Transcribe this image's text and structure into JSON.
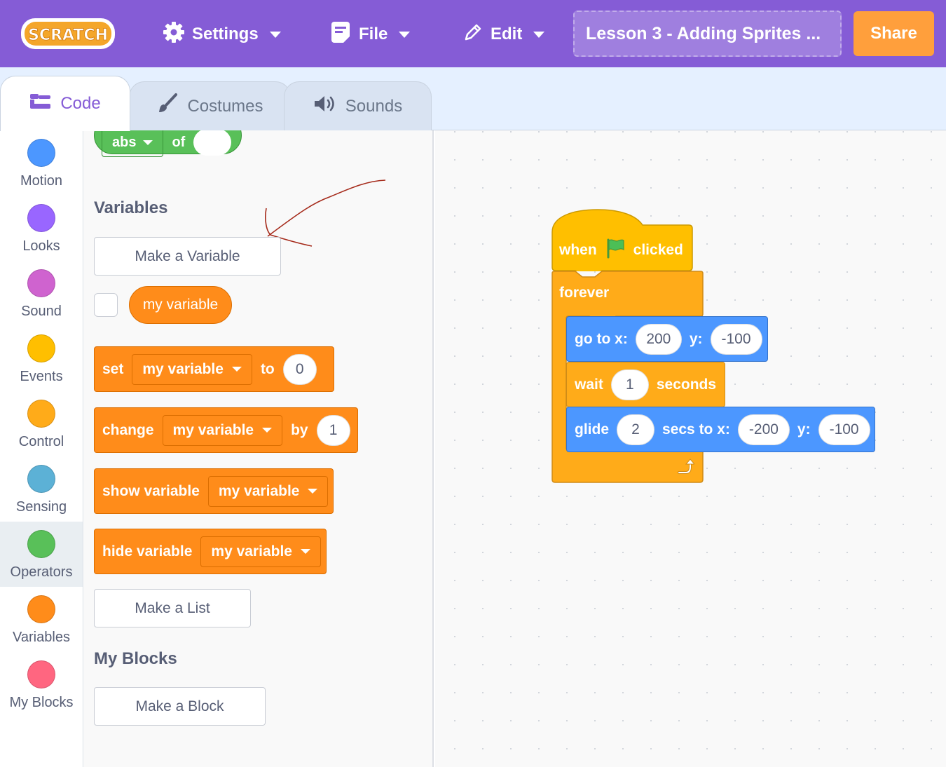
{
  "menubar": {
    "logo_text": "SCRATCH",
    "settings_label": "Settings",
    "file_label": "File",
    "edit_label": "Edit",
    "project_title": "Lesson 3 - Adding Sprites ...",
    "share_label": "Share",
    "color": "#855cd6"
  },
  "tabs": {
    "code_label": "Code",
    "costumes_label": "Costumes",
    "sounds_label": "Sounds"
  },
  "categories": [
    {
      "label": "Motion",
      "color": "#4c97ff"
    },
    {
      "label": "Looks",
      "color": "#9966ff"
    },
    {
      "label": "Sound",
      "color": "#cf63cf"
    },
    {
      "label": "Events",
      "color": "#ffbf00"
    },
    {
      "label": "Control",
      "color": "#ffab19"
    },
    {
      "label": "Sensing",
      "color": "#5cb1d6"
    },
    {
      "label": "Operators",
      "color": "#59c059"
    },
    {
      "label": "Variables",
      "color": "#ff8c1a"
    },
    {
      "label": "My Blocks",
      "color": "#ff6680"
    }
  ],
  "palette": {
    "abs_block": {
      "op": "abs",
      "of": "of"
    },
    "variables_title": "Variables",
    "make_variable": "Make a Variable",
    "variable_reporter": "my variable",
    "set_block": {
      "label": "set",
      "var": "my variable",
      "to": "to",
      "value": "0"
    },
    "change_block": {
      "label": "change",
      "var": "my variable",
      "by": "by",
      "value": "1"
    },
    "show_block": {
      "label": "show variable",
      "var": "my variable"
    },
    "hide_block": {
      "label": "hide variable",
      "var": "my variable"
    },
    "make_list": "Make a List",
    "myblocks_title": "My Blocks",
    "make_block": "Make a Block"
  },
  "script": {
    "hat": {
      "when": "when",
      "clicked": "clicked"
    },
    "forever": "forever",
    "goto": {
      "label": "go to x:",
      "x": "200",
      "y_label": "y:",
      "y": "-100"
    },
    "wait": {
      "label": "wait",
      "value": "1",
      "unit": "seconds"
    },
    "glide": {
      "label": "glide",
      "secs": "2",
      "mid": "secs to x:",
      "x": "-200",
      "y_label": "y:",
      "y": "-100"
    }
  }
}
